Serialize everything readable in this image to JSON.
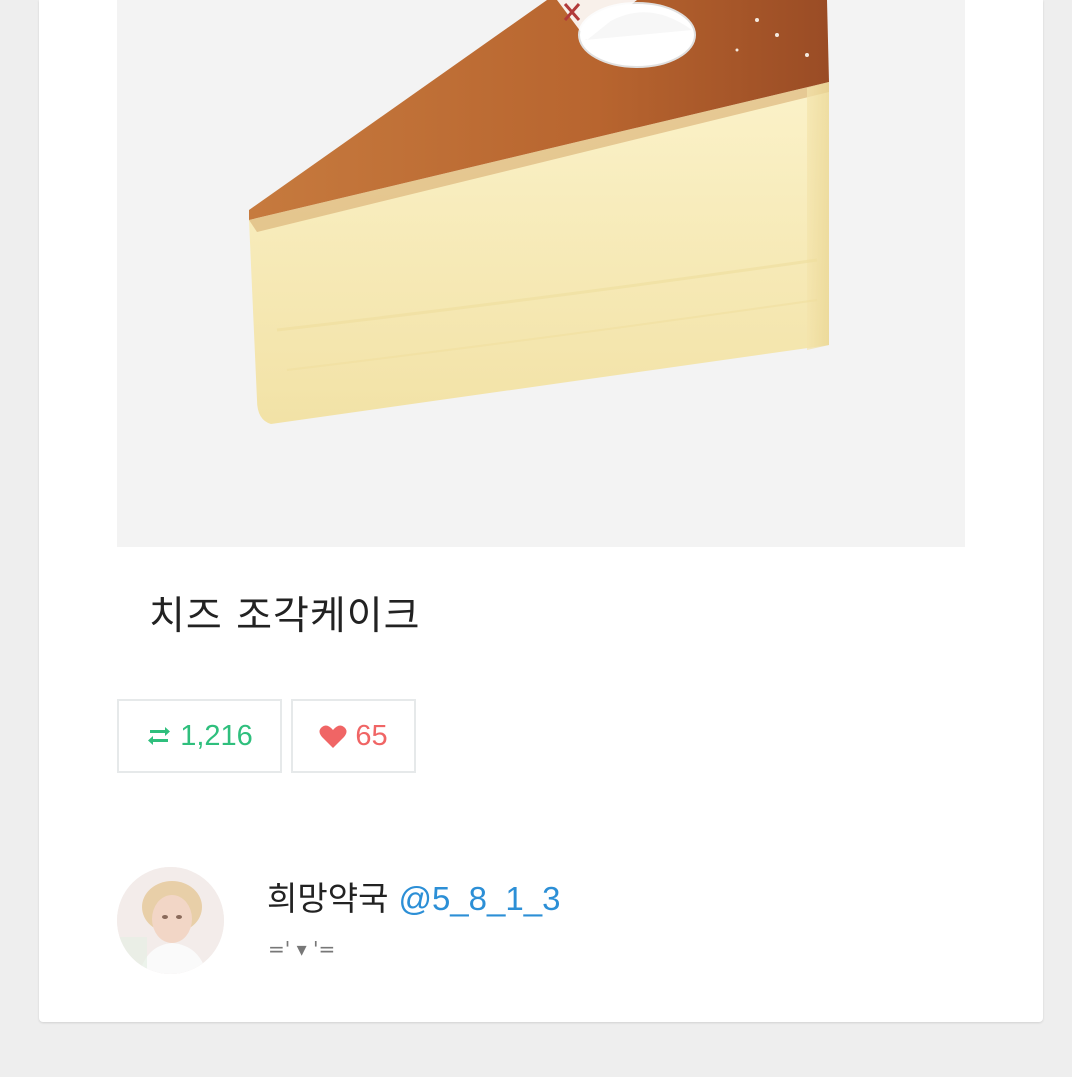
{
  "post": {
    "image_alt": "cheesecake slice photo",
    "caption": "치즈 조각케이크"
  },
  "stats": {
    "retweet_icon": "retweet-icon",
    "retweet_count": "1,216",
    "like_icon": "heart-icon",
    "like_count": "65"
  },
  "author": {
    "display_name": "희망약국",
    "handle": "@5_8_1_3",
    "bio": "=' ▾ '="
  },
  "colors": {
    "retweet_green": "#2fbf7d",
    "like_red": "#f06565",
    "handle_blue": "#2c8fd6"
  }
}
